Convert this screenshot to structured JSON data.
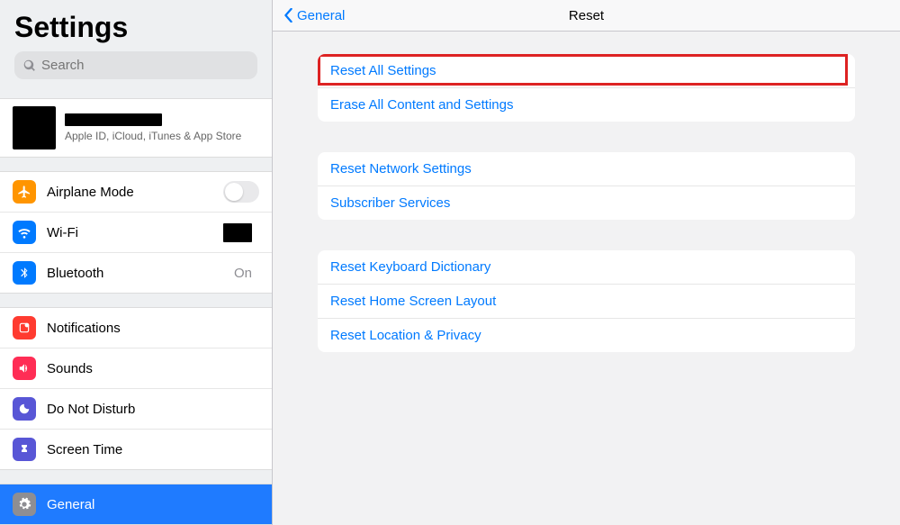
{
  "sidebar": {
    "title": "Settings",
    "search_placeholder": "Search",
    "account_sub": "Apple ID, iCloud, iTunes & App Store",
    "rows1": {
      "airplane": "Airplane Mode",
      "wifi": "Wi-Fi",
      "bt": "Bluetooth",
      "bt_value": "On"
    },
    "rows2": {
      "notif": "Notifications",
      "sounds": "Sounds",
      "dnd": "Do Not Disturb",
      "screentime": "Screen Time"
    },
    "rows3": {
      "general": "General"
    }
  },
  "main": {
    "back": "General",
    "title": "Reset",
    "groups": [
      [
        "Reset All Settings",
        "Erase All Content and Settings"
      ],
      [
        "Reset Network Settings",
        "Subscriber Services"
      ],
      [
        "Reset Keyboard Dictionary",
        "Reset Home Screen Layout",
        "Reset Location & Privacy"
      ]
    ]
  }
}
